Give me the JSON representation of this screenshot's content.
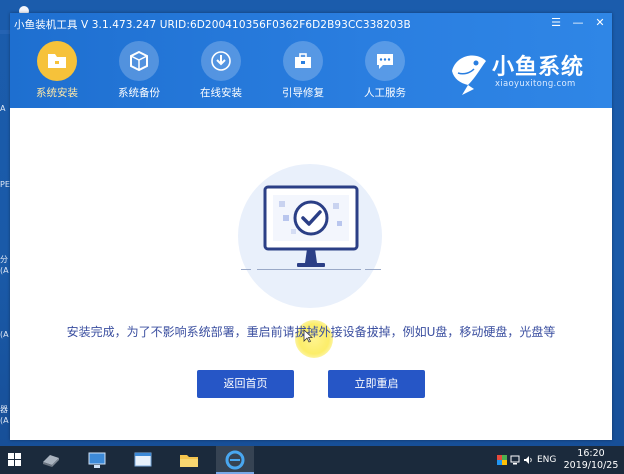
{
  "window": {
    "title": "小鱼装机工具 V 3.1.473.247 URID:6D200410356F0362F6D2B93CC338203B",
    "controls": {
      "menu": "☰",
      "minimize": "—",
      "close": "✕"
    }
  },
  "nav": {
    "items": [
      {
        "label": "系统安装",
        "icon": "folder-icon",
        "active": true
      },
      {
        "label": "系统备份",
        "icon": "cube-icon",
        "active": false
      },
      {
        "label": "在线安装",
        "icon": "download-icon",
        "active": false
      },
      {
        "label": "引导修复",
        "icon": "toolbox-icon",
        "active": false
      },
      {
        "label": "人工服务",
        "icon": "chat-icon",
        "active": false
      }
    ]
  },
  "brand": {
    "title": "小鱼系统",
    "subtitle": "xiaoyuxitong.com"
  },
  "main": {
    "message": "安装完成，为了不影响系统部署，重启前请拔掉外接设备拔掉，例如U盘，移动硬盘，光盘等",
    "buttons": {
      "back": "返回首页",
      "restart": "立即重启"
    }
  },
  "taskbar": {
    "language": "ENG",
    "time": "16:20",
    "date": "2019/10/25"
  },
  "colors": {
    "header": "#2a7ee0",
    "active_nav": "#f6c23a",
    "button": "#2656c6",
    "message_text": "#3b4fa0",
    "desktop": "#1b5cac",
    "taskbar": "#1b2a3c"
  }
}
